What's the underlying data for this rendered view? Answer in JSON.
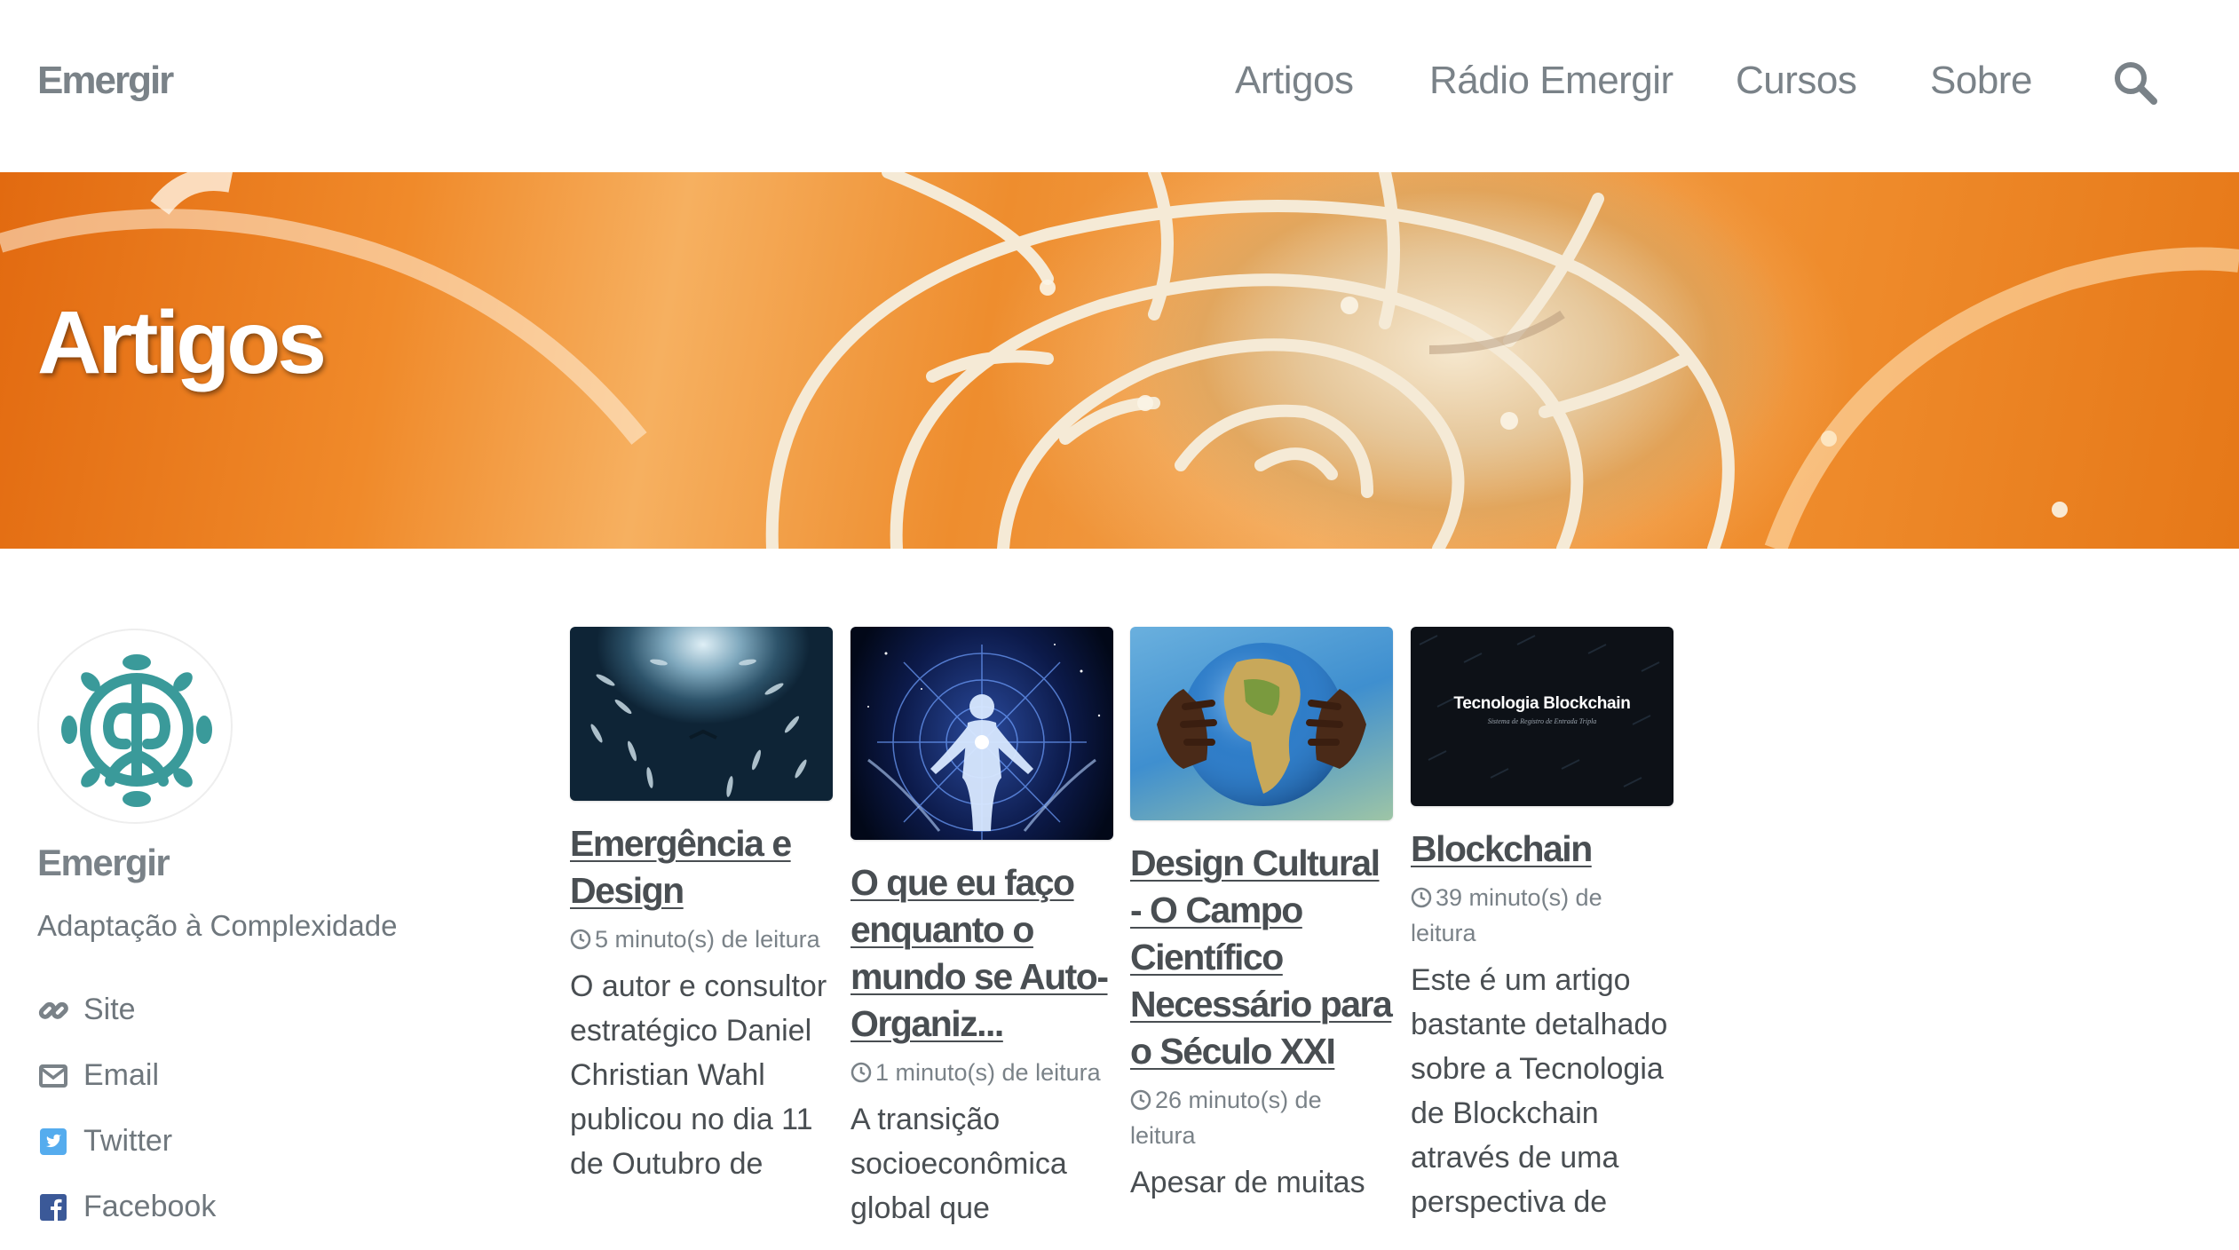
{
  "masthead": {
    "site_title": "Emergir",
    "nav": [
      "Artigos",
      "Rádio Emergir",
      "Cursos",
      "Sobre"
    ],
    "search_icon": "search-icon"
  },
  "hero": {
    "title": "Artigos"
  },
  "author": {
    "name": "Emergir",
    "bio": "Adaptação à Complexidade",
    "links": [
      {
        "label": "Site",
        "icon": "link-icon"
      },
      {
        "label": "Email",
        "icon": "envelope-icon"
      },
      {
        "label": "Twitter",
        "icon": "twitter-icon"
      },
      {
        "label": "Facebook",
        "icon": "facebook-icon"
      }
    ]
  },
  "articles": [
    {
      "title": "Emergência e Design",
      "read_time": "5 minuto(s) de leitura",
      "excerpt": "O autor e consultor estratégico Daniel Christian Wahl publicou no dia 11 de Outubro de"
    },
    {
      "title": "O que eu faço enquanto o mundo se Auto-Organiz...",
      "read_time": "1 minuto(s) de leitura",
      "excerpt": "A transição socioeconômica global que"
    },
    {
      "title": "Design Cultural - O Campo Científico Necessário para o Século XXI",
      "read_time": "26 minuto(s) de leitura",
      "excerpt": "Apesar de muitas"
    },
    {
      "title": "Blockchain",
      "read_time": "39 minuto(s) de leitura",
      "excerpt": "Este é um artigo bastante detalhado sobre a Tecnologia de Blockchain através de uma perspectiva de",
      "thumb_title": "Tecnologia Blockchain",
      "thumb_subtitle": "Sistema de Registro de Entrada Tripla"
    }
  ],
  "colors": {
    "text": "#494e52",
    "muted": "#7a8288",
    "logo_teal": "#3a9a9a",
    "twitter": "#55acee",
    "facebook": "#3b5998"
  }
}
